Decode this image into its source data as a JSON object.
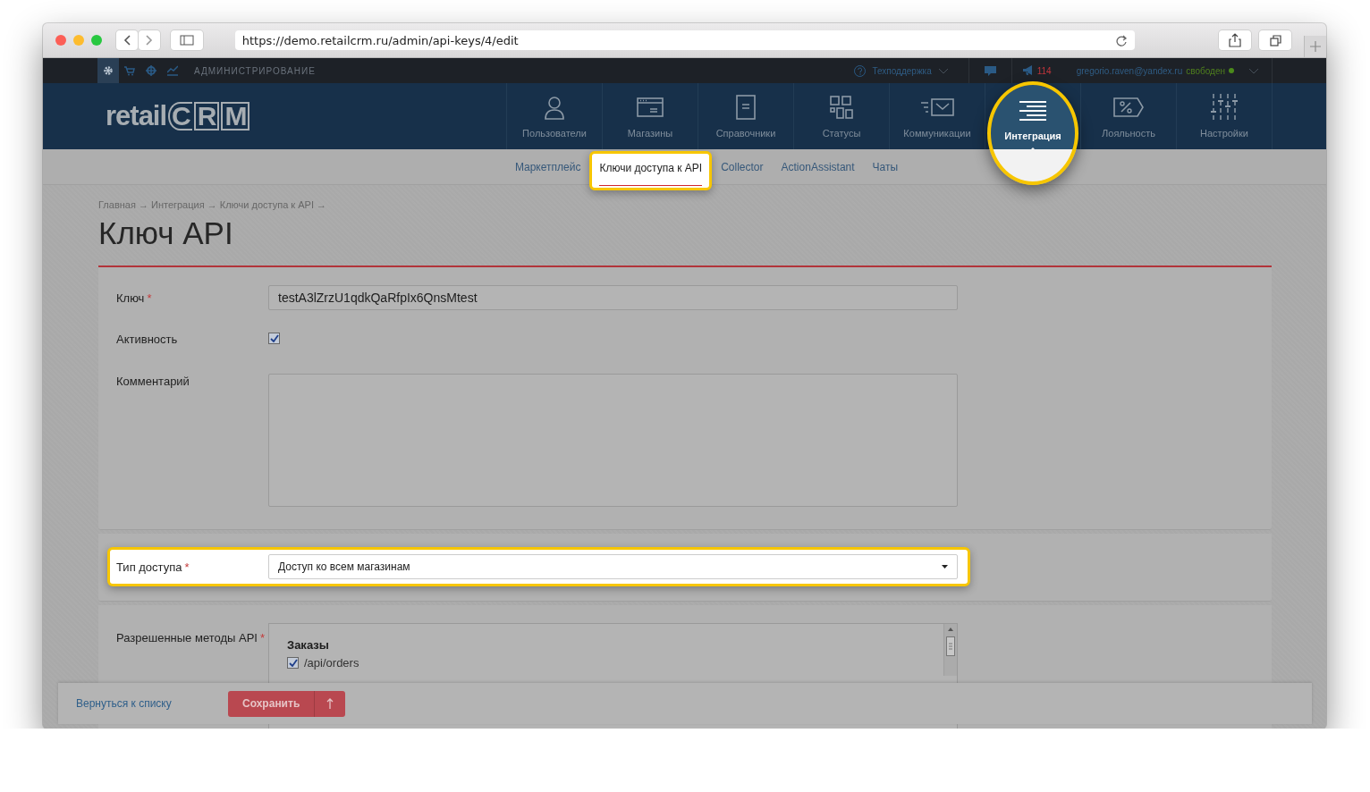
{
  "browser": {
    "url": "https://demo.retailcrm.ru/admin/api-keys/4/edit"
  },
  "admin_bar": {
    "section": "АДМИНИСТРИРОВАНИЕ",
    "support": "Техподдержка",
    "notifications": "114",
    "user_email": "gregorio.raven@yandex.ru",
    "user_status": "свободен"
  },
  "logo": {
    "word": "retail",
    "letters": [
      "C",
      "R",
      "M"
    ]
  },
  "nav": [
    {
      "label": "Пользователи",
      "selected": false
    },
    {
      "label": "Магазины",
      "selected": false
    },
    {
      "label": "Справочники",
      "selected": false
    },
    {
      "label": "Статусы",
      "selected": false
    },
    {
      "label": "Коммуникации",
      "selected": false
    },
    {
      "label": "Интеграция",
      "selected": true
    },
    {
      "label": "Лояльность",
      "selected": false
    },
    {
      "label": "Настройки",
      "selected": false
    }
  ],
  "sub_nav": [
    {
      "label": "Маркетплейс",
      "selected": false
    },
    {
      "label": "Ключи доступа к API",
      "selected": true
    },
    {
      "label": "Collector",
      "selected": false
    },
    {
      "label": "ActionAssistant",
      "selected": false
    },
    {
      "label": "Чаты",
      "selected": false
    }
  ],
  "breadcrumb": "Главная → Интеграция → Ключи доступа к API →",
  "title": "Ключ API",
  "sections": [
    {
      "highlighted": false,
      "fields": [
        {
          "kind": "text",
          "label": "Ключ",
          "required_mark": "*",
          "value": "testA3lZrzU1qdkQaRfpIx6QnsMtest"
        },
        {
          "kind": "checkbox",
          "label": "Активность",
          "checked": true
        },
        {
          "kind": "textarea",
          "label": "Комментарий"
        }
      ]
    },
    {
      "highlighted": true,
      "fields": [
        {
          "kind": "select",
          "label": "Тип доступа",
          "required_mark": "*",
          "value": "Доступ ко всем магазинам"
        }
      ]
    },
    {
      "highlighted": false,
      "fields": [
        {
          "kind": "methods",
          "label": "Разрешенные методы API",
          "required_mark": "*",
          "group": "Заказы",
          "methods": [
            {
              "label": "/api/orders",
              "checked": true
            }
          ]
        }
      ]
    }
  ],
  "footer": {
    "back_link": "Вернуться к списку",
    "save_button": "Сохранить"
  }
}
